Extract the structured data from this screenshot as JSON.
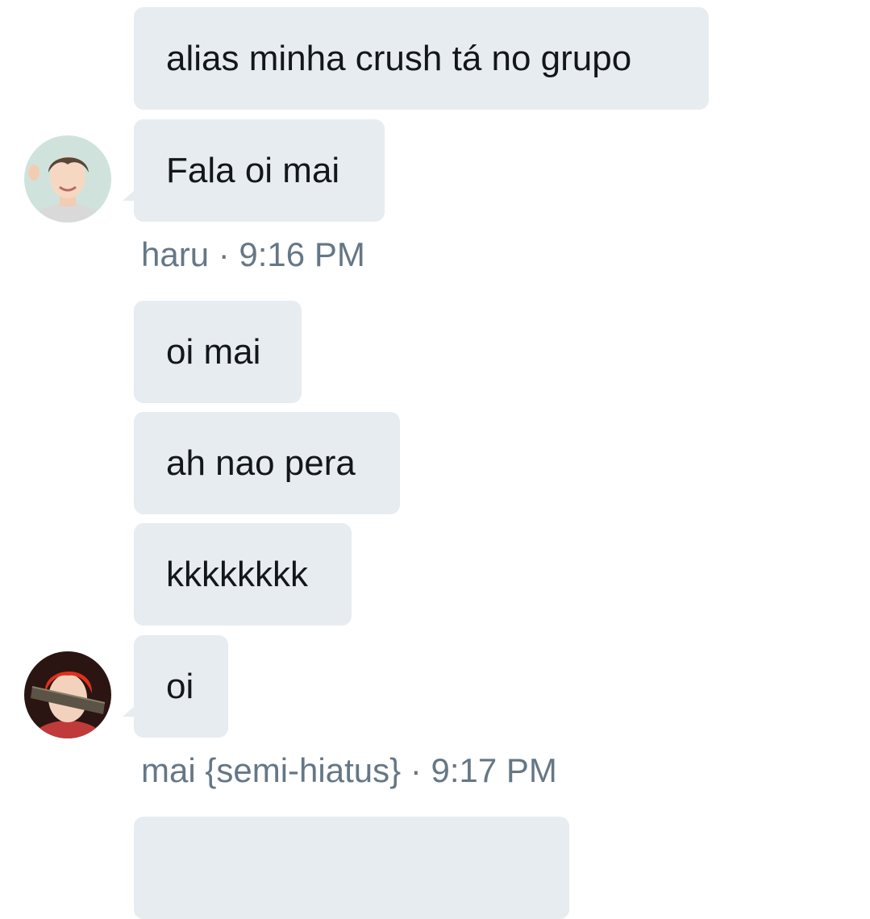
{
  "conversation": {
    "group1": {
      "messages": [
        "alias minha crush tá no grupo",
        "Fala oi mai"
      ],
      "sender_name": "haru",
      "separator": "·",
      "timestamp": "9:16 PM",
      "avatar_icon": "haru-avatar"
    },
    "group2": {
      "messages": [
        "oi mai",
        "ah nao pera",
        "kkkkkkkk",
        "oi"
      ],
      "sender_name": "mai {semi-hiatus}",
      "separator": "·",
      "timestamp": "9:17 PM",
      "avatar_icon": "mai-avatar"
    }
  },
  "colors": {
    "bubble_bg": "#e6ecf0",
    "meta_text": "#657786",
    "message_text": "#14171a"
  }
}
